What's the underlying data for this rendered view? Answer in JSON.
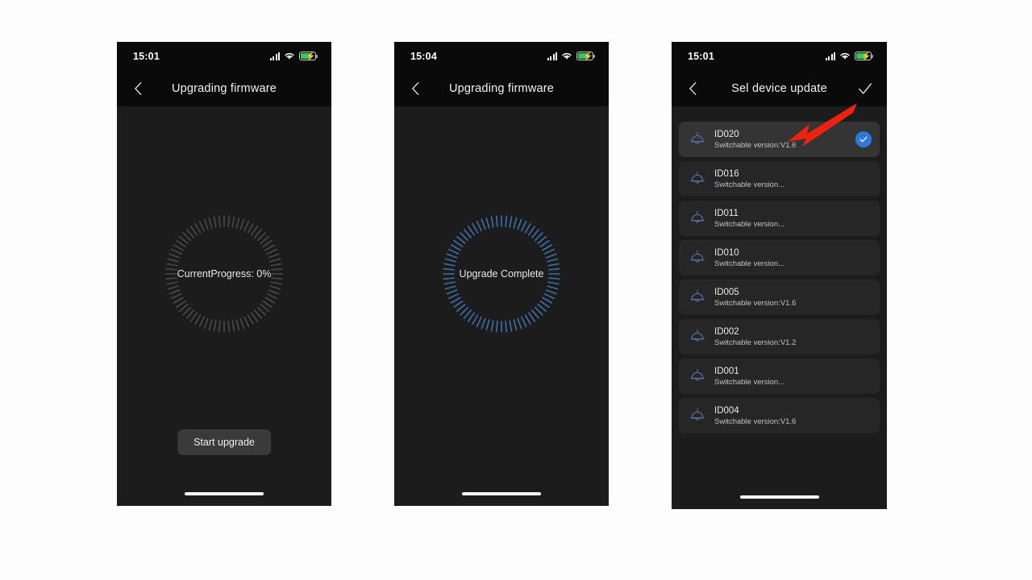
{
  "phones": [
    {
      "id": "upgrade-start",
      "status": {
        "time": "15:01",
        "signal_icon": "signal-bars-icon",
        "wifi_icon": "wifi-icon",
        "battery_icon": "battery-charging-icon"
      },
      "nav": {
        "back_icon": "chevron-left-icon",
        "title": "Upgrading firmware"
      },
      "progress": {
        "label": "CurrentProgress: 0%",
        "percent": 0,
        "tick_count": 72,
        "tick_color_off": "#4a4a4a",
        "tick_color_on": "#3f6fa8"
      },
      "button": {
        "label": "Start upgrade"
      }
    },
    {
      "id": "upgrade-complete",
      "status": {
        "time": "15:04",
        "signal_icon": "signal-bars-icon",
        "wifi_icon": "wifi-icon",
        "battery_icon": "battery-charging-icon"
      },
      "nav": {
        "back_icon": "chevron-left-icon",
        "title": "Upgrading firmware"
      },
      "progress": {
        "label": "Upgrade Complete",
        "percent": 100,
        "tick_count": 72,
        "tick_color_off": "#4a4a4a",
        "tick_color_on": "#3f6fa8"
      }
    },
    {
      "id": "select-device",
      "status": {
        "time": "15:01",
        "signal_icon": "signal-bars-icon",
        "wifi_icon": "wifi-icon",
        "battery_icon": "battery-charging-icon"
      },
      "nav": {
        "back_icon": "chevron-left-icon",
        "title": "Sel device update",
        "confirm_icon": "checkmark-icon"
      },
      "devices": [
        {
          "name": "ID020",
          "version": "Switchable version:V1.6",
          "selected": true,
          "icon": "pendant-lamp-icon"
        },
        {
          "name": "ID016",
          "version": "Switchable version...",
          "selected": false,
          "icon": "pendant-lamp-icon"
        },
        {
          "name": "ID011",
          "version": "Switchable version...",
          "selected": false,
          "icon": "pendant-lamp-icon"
        },
        {
          "name": "ID010",
          "version": "Switchable version...",
          "selected": false,
          "icon": "pendant-lamp-icon"
        },
        {
          "name": "ID005",
          "version": "Switchable version:V1.6",
          "selected": false,
          "icon": "pendant-lamp-icon"
        },
        {
          "name": "ID002",
          "version": "Switchable version:V1.2",
          "selected": false,
          "icon": "pendant-lamp-icon"
        },
        {
          "name": "ID001",
          "version": "Switchable version...",
          "selected": false,
          "icon": "pendant-lamp-icon"
        },
        {
          "name": "ID004",
          "version": "Switchable version:V1.6",
          "selected": false,
          "icon": "pendant-lamp-icon"
        }
      ]
    }
  ],
  "annotation": {
    "icon": "red-arrow-icon",
    "color": "#ee2211"
  },
  "colors": {
    "page_background": "#fdfdfd",
    "phone_background": "#1c1c1c",
    "bar_background": "#0a0a0a",
    "row_background": "#262626",
    "row_selected_background": "#343434",
    "accent_blue": "#2d79d8",
    "battery_green": "#34c759"
  }
}
